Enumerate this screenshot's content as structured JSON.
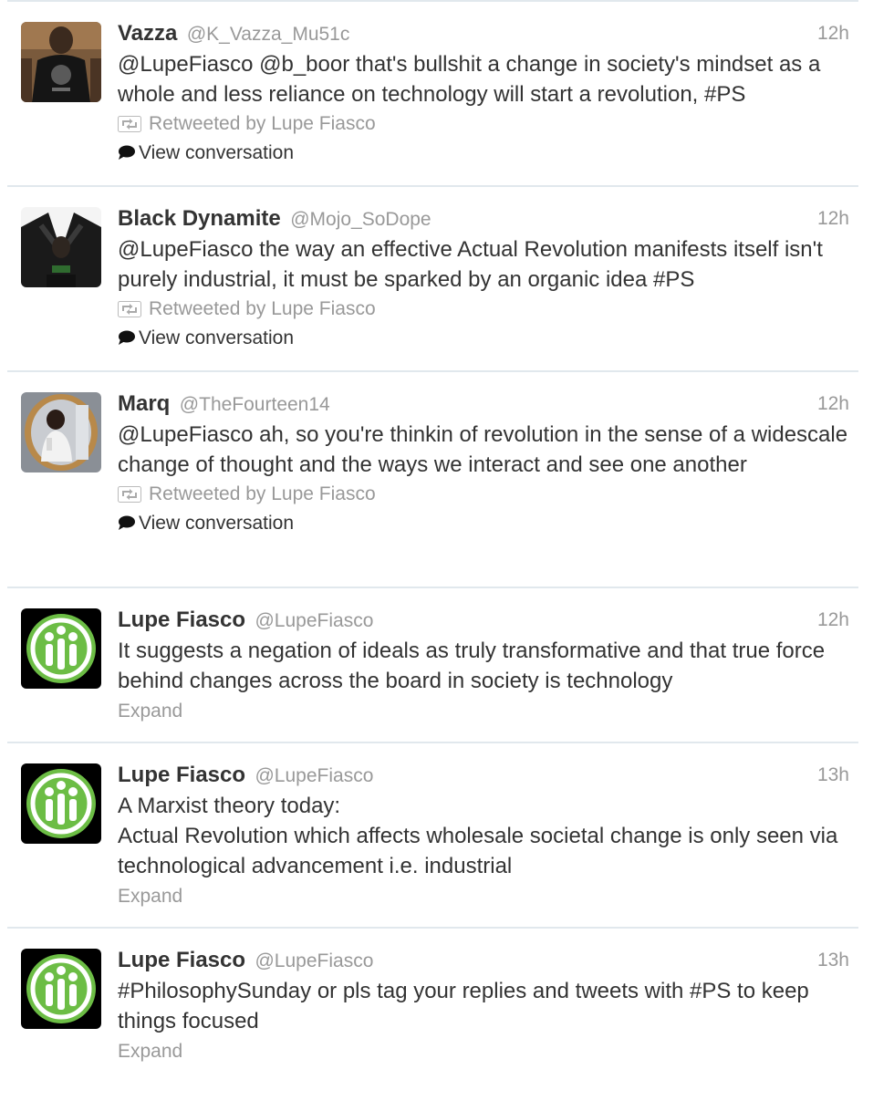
{
  "tweets": [
    {
      "fullname": "Vazza",
      "username": "@K_Vazza_Mu51c",
      "time": "12h",
      "text": "@LupeFiasco @b_boor that's bullshit a change in society's mindset as a whole and less reliance on technology will start a revolution, #PS",
      "retweeted_by": "Retweeted by Lupe Fiasco",
      "action": "View conversation",
      "avatar": "vazza-avatar"
    },
    {
      "fullname": "Black Dynamite",
      "username": "@Mojo_SoDope",
      "time": "12h",
      "text": "@LupeFiasco the way an effective Actual Revolution manifests itself isn't purely industrial, it must be sparked by an organic idea #PS",
      "retweeted_by": "Retweeted by Lupe Fiasco",
      "action": "View conversation",
      "avatar": "black-dynamite-avatar"
    },
    {
      "fullname": "Marq",
      "username": "@TheFourteen14",
      "time": "12h",
      "text": "@LupeFiasco ah, so you're thinkin of revolution in the sense of a widescale change of thought and the ways we interact and see one another",
      "retweeted_by": "Retweeted by Lupe Fiasco",
      "action": "View conversation",
      "avatar": "marq-avatar"
    },
    {
      "fullname": "Lupe Fiasco",
      "username": "@LupeFiasco",
      "time": "12h",
      "text": "It suggests a negation of ideals as truly transformative and that true force behind changes across the board in society is technology",
      "action": "Expand",
      "avatar": "lupe-fiasco-avatar"
    },
    {
      "fullname": "Lupe Fiasco",
      "username": "@LupeFiasco",
      "time": "13h",
      "text": "A Marxist theory today:\nActual Revolution which affects wholesale societal change is only seen via technological advancement i.e. industrial",
      "action": "Expand",
      "avatar": "lupe-fiasco-avatar"
    },
    {
      "fullname": "Lupe Fiasco",
      "username": "@LupeFiasco",
      "time": "13h",
      "text": "#PhilosophySunday or pls tag your replies and tweets with #PS to keep things focused",
      "action": "Expand",
      "avatar": "lupe-fiasco-avatar"
    }
  ],
  "colors": {
    "name": "#333333",
    "muted": "#999999",
    "divider": "#e1e8ed",
    "lupe_green": "#6cbd45"
  }
}
